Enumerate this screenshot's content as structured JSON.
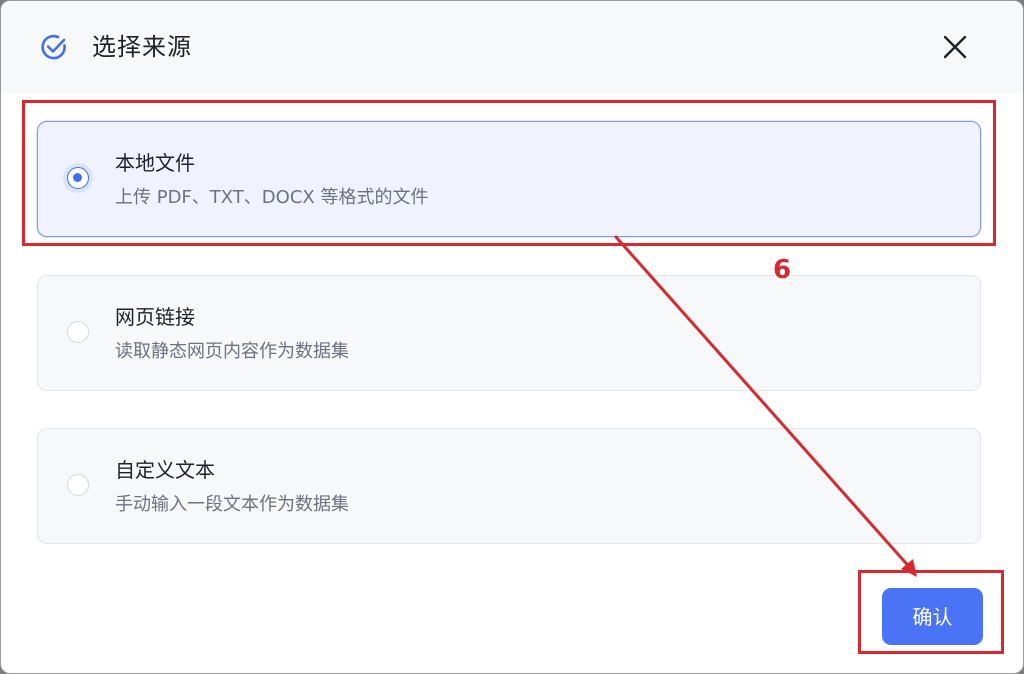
{
  "dialog": {
    "title": "选择来源",
    "icon": "check-circle-icon",
    "close_icon": "close-icon"
  },
  "options": [
    {
      "title": "本地文件",
      "description": "上传 PDF、TXT、DOCX 等格式的文件",
      "selected": true
    },
    {
      "title": "网页链接",
      "description": "读取静态网页内容作为数据集",
      "selected": false
    },
    {
      "title": "自定义文本",
      "description": "手动输入一段文本作为数据集",
      "selected": false
    }
  ],
  "footer": {
    "confirm_label": "确认"
  },
  "annotation": {
    "step_number": "6",
    "color": "#d9282f"
  },
  "colors": {
    "accent": "#4a74f5",
    "selected_bg": "#f0f3ff"
  }
}
